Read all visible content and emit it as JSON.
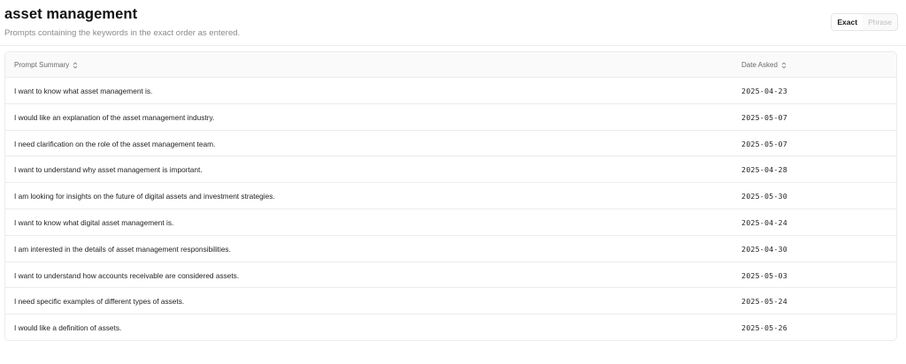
{
  "header": {
    "title": "asset management",
    "subtitle": "Prompts containing the keywords in the exact order as entered.",
    "toggle": {
      "exact_label": "Exact",
      "phrase_label": "Phrase",
      "selected": "Exact"
    }
  },
  "table": {
    "columns": {
      "summary": "Prompt Summary",
      "date": "Date Asked"
    },
    "rows": [
      {
        "summary": "I want to know what asset management is.",
        "date": "2025-04-23"
      },
      {
        "summary": "I would like an explanation of the asset management industry.",
        "date": "2025-05-07"
      },
      {
        "summary": "I need clarification on the role of the asset management team.",
        "date": "2025-05-07"
      },
      {
        "summary": "I want to understand why asset management is important.",
        "date": "2025-04-28"
      },
      {
        "summary": "I am looking for insights on the future of digital assets and investment strategies.",
        "date": "2025-05-30"
      },
      {
        "summary": "I want to know what digital asset management is.",
        "date": "2025-04-24"
      },
      {
        "summary": "I am interested in the details of asset management responsibilities.",
        "date": "2025-04-30"
      },
      {
        "summary": "I want to understand how accounts receivable are considered assets.",
        "date": "2025-05-03"
      },
      {
        "summary": "I need specific examples of different types of assets.",
        "date": "2025-05-24"
      },
      {
        "summary": "I would like a definition of assets.",
        "date": "2025-05-26"
      }
    ]
  },
  "icons": {
    "sort": "sort-updown-icon"
  },
  "colors": {
    "border": "#ececec",
    "header_bg": "#fafafa",
    "muted_text": "#8a8a8a",
    "text": "#1f1f1f"
  }
}
